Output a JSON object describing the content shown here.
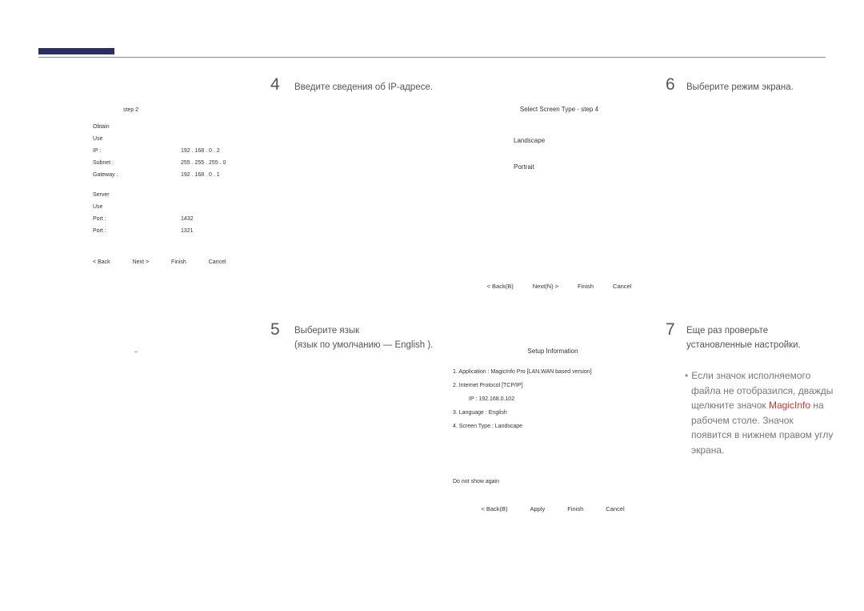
{
  "steps": {
    "s4": {
      "num": "4",
      "title": "Введите сведения об IP-адресе."
    },
    "s5": {
      "num": "5",
      "title_line1": "Выберите язык",
      "title_line2": "(язык по умолчанию — English )."
    },
    "s6": {
      "num": "6",
      "title": "Выберите режим экрана."
    },
    "s7": {
      "num": "7",
      "title_line1": "Еще раз проверьте",
      "title_line2": "установленные настройки."
    }
  },
  "ip_dialog": {
    "header": "step 2",
    "rows1": [
      {
        "label": "Obtain",
        "value": ""
      },
      {
        "label": "Use",
        "value": ""
      },
      {
        "label": "IP :",
        "value": "192 . 168 . 0 . 2"
      },
      {
        "label": "Subnet :",
        "value": "255 . 255 . 255 . 0"
      },
      {
        "label": "Gateway :",
        "value": "192 . 168 . 0 . 1"
      }
    ],
    "rows2_header": "Server",
    "rows2": [
      {
        "label": "Use",
        "value": ""
      },
      {
        "label": "Port :",
        "value": "1432"
      },
      {
        "label": "Port :",
        "value": "1321"
      }
    ],
    "buttons": {
      "back": "< Back",
      "next": "Next >",
      "finish": "Finish",
      "cancel": "Cancel"
    }
  },
  "lang_dialog": {
    "marker": "–"
  },
  "screen_dialog": {
    "header": "Select Screen Type - step 4",
    "opt1": "Landscape",
    "opt2": "Portrait",
    "buttons": {
      "back": "< Back(B)",
      "next": "Next(N) >",
      "finish": "Finish",
      "cancel": "Cancel"
    }
  },
  "setup_info_dialog": {
    "header": "Setup Information",
    "line1": "1. Application :   MagicInfo Pro [LAN,WAN based version]",
    "line2": "2. Internet Protocol [TCP/IP]",
    "line2_sub": "IP :    192.168.0.102",
    "line3": "3. Language :    English",
    "line4": "4. Screen Type :   Landscape",
    "checkbox": "Do not show again",
    "buttons": {
      "back": "< Back(B)",
      "apply": "Apply",
      "finish": "Finish",
      "cancel": "Cancel"
    }
  },
  "note": {
    "bullet": "•",
    "part1": "Если значок исполняемого файла не отобразился, дважды щелкните значок ",
    "brand": "MagicInfo",
    "part2": " на рабочем столе. Значок появится в нижнем правом углу экрана."
  }
}
